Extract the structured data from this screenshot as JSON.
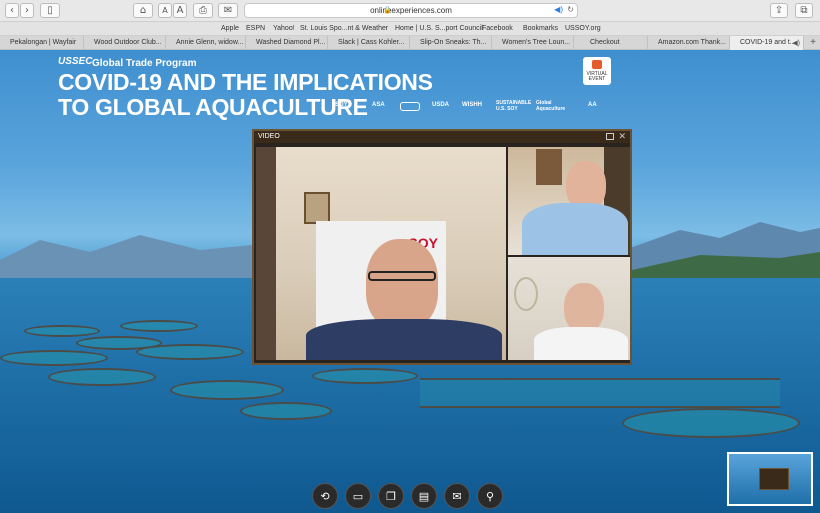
{
  "browser": {
    "url": "onlineexperiences.com",
    "bookmarks": [
      "Apple",
      "ESPN",
      "Yahoo!",
      "St. Louis Spo...nt & Weather",
      "Home | U.S. S...port Council",
      "Facebook",
      "Bookmarks",
      "USSOY.org"
    ],
    "tabs": [
      "Pekalongan | Wayfair",
      "Wood Outdoor Club...",
      "Annie Glenn, widow...",
      "Washed Diamond Pl...",
      "Slack | Cass Kohler...",
      "Slip-On Sneaks: Th...",
      "Women's Tree Loun...",
      "Checkout",
      "Amazon.com Thank...",
      "COVID-19 and t..."
    ],
    "active_tab": 9
  },
  "banner": {
    "logo": "USSEC",
    "program": "Global Trade Program",
    "title_line1": "COVID-19 AND THE IMPLICATIONS",
    "title_line2": "TO GLOBAL AQUACULTURE",
    "badge": "VIRTUAL EVENT",
    "sponsors": [
      "SOY",
      "ASA",
      "",
      "USDA",
      "WISHH",
      "SUSTAINABLE U.S. SOY",
      "Global Aquaculture",
      "AA"
    ]
  },
  "video": {
    "title": "VIDEO",
    "backdrop_text": "SOY"
  },
  "controls": [
    {
      "name": "replay",
      "glyph": "⟲"
    },
    {
      "name": "screen",
      "glyph": "▭"
    },
    {
      "name": "slides",
      "glyph": "❐"
    },
    {
      "name": "documents",
      "glyph": "▤"
    },
    {
      "name": "chat",
      "glyph": "✉"
    },
    {
      "name": "profile",
      "glyph": "⚲"
    }
  ]
}
